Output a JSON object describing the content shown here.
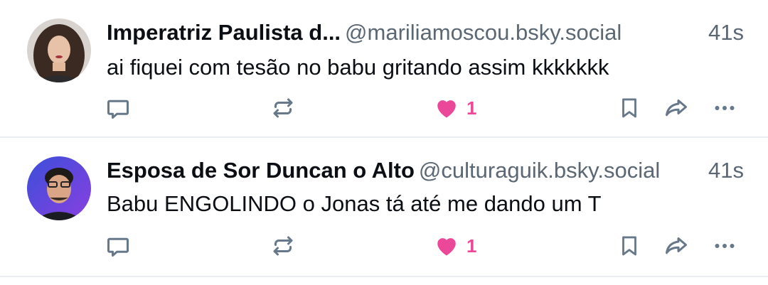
{
  "colors": {
    "like": "#ec4899",
    "icon": "#66788a",
    "muted": "#5b6773",
    "divider": "#e9edf1"
  },
  "posts": [
    {
      "display_name": "Imperatriz Paulista d...",
      "handle": "@mariliamoscou.bsky.social",
      "time": "41s",
      "text": "ai fiquei com tesão no babu gritando assim kkkkkkk",
      "like_count": "1",
      "liked": true
    },
    {
      "display_name": "Esposa de Sor Duncan o Alto",
      "handle": "@culturaguik.bsky.social",
      "time": "41s",
      "text": "Babu ENGOLINDO o Jonas tá até me dando um T",
      "like_count": "1",
      "liked": true
    }
  ],
  "icons": [
    "reply-icon",
    "repost-icon",
    "heart-icon",
    "bookmark-icon",
    "share-icon",
    "more-icon"
  ]
}
